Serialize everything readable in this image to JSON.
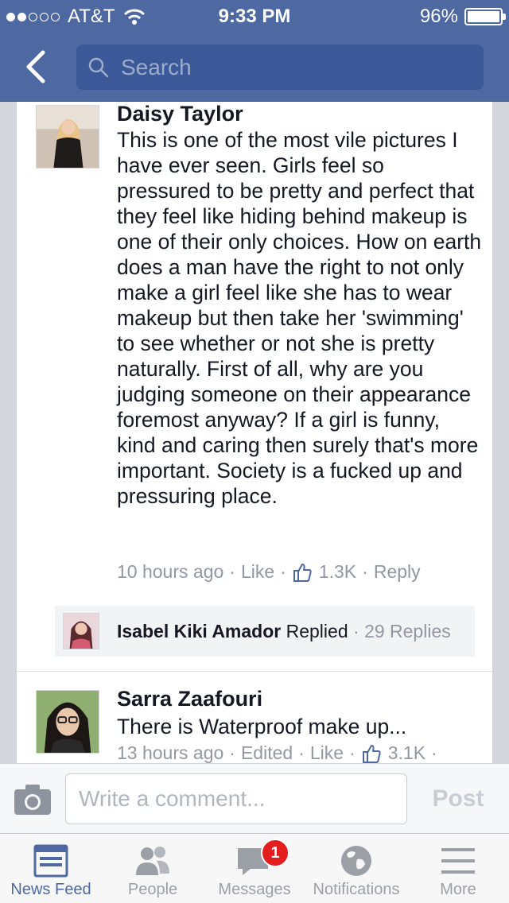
{
  "status_bar": {
    "carrier": "AT&T",
    "time": "9:33 PM",
    "battery": "96%"
  },
  "nav": {
    "search_placeholder": "Search"
  },
  "comments": [
    {
      "author": "Daisy Taylor",
      "text": "This is one of the most vile pictures I have ever seen. Girls feel so pressured to be pretty and perfect that they feel like hiding behind makeup is one of their only choices. How on earth does a man have the right to not only make a girl feel like she has to wear makeup but then take her 'swimming' to see whether or not she is pretty naturally. First of all, why are you judging someone on their appearance foremost anyway? If a girl is funny, kind and caring then surely that's more important. Society is a fucked up and pressuring place.",
      "time": "10 hours ago",
      "like_label": "Like",
      "like_count": "1.3K",
      "reply_label": "Reply",
      "reply_summary": {
        "author": "Isabel Kiki Amador",
        "action": "Replied",
        "count": "29 Replies"
      }
    },
    {
      "author": "Sarra Zaafouri",
      "text": "There is Waterproof make up...",
      "time": "13 hours ago",
      "edited_label": "Edited",
      "like_label": "Like",
      "like_count": "3.1K"
    }
  ],
  "composer": {
    "placeholder": "Write a comment...",
    "post_label": "Post"
  },
  "tabs": [
    {
      "label": "News Feed",
      "icon": "news-feed-icon",
      "active": true
    },
    {
      "label": "People",
      "icon": "people-icon"
    },
    {
      "label": "Messages",
      "icon": "messages-icon",
      "badge": "1"
    },
    {
      "label": "Notifications",
      "icon": "globe-icon"
    },
    {
      "label": "More",
      "icon": "menu-icon"
    }
  ],
  "colors": {
    "brand": "#4e69a2",
    "badge": "#e41e1e"
  }
}
